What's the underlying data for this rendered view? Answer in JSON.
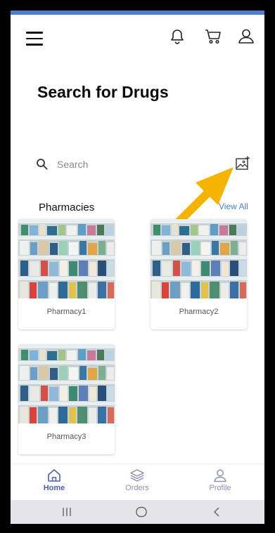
{
  "header": {
    "menu_icon": "hamburger-menu-icon",
    "notifications_icon": "bell-icon",
    "cart_icon": "cart-icon",
    "profile_icon": "user-icon"
  },
  "page": {
    "title": "Search for Drugs"
  },
  "search": {
    "placeholder": "Search",
    "value": "",
    "image_search_icon": "image-add-icon"
  },
  "pharmacies": {
    "section_title": "Pharmacies",
    "view_all_label": "View All",
    "items": [
      {
        "name": "Pharmacy1"
      },
      {
        "name": "Pharmacy2"
      },
      {
        "name": "Pharmacy3"
      }
    ]
  },
  "bottom_nav": {
    "items": [
      {
        "label": "Home",
        "icon": "home-icon",
        "active": true
      },
      {
        "label": "Orders",
        "icon": "layers-icon",
        "active": false
      },
      {
        "label": "Profile",
        "icon": "user-icon",
        "active": false
      }
    ]
  },
  "system_nav": {
    "recents_icon": "recents-icon",
    "home_icon": "circle-home-icon",
    "back_icon": "back-chevron-icon"
  },
  "colors": {
    "accent": "#4a7fd6",
    "arrow": "#f5b400",
    "nav_active": "#4b5fb8",
    "nav_inactive": "#8e8fb0"
  }
}
